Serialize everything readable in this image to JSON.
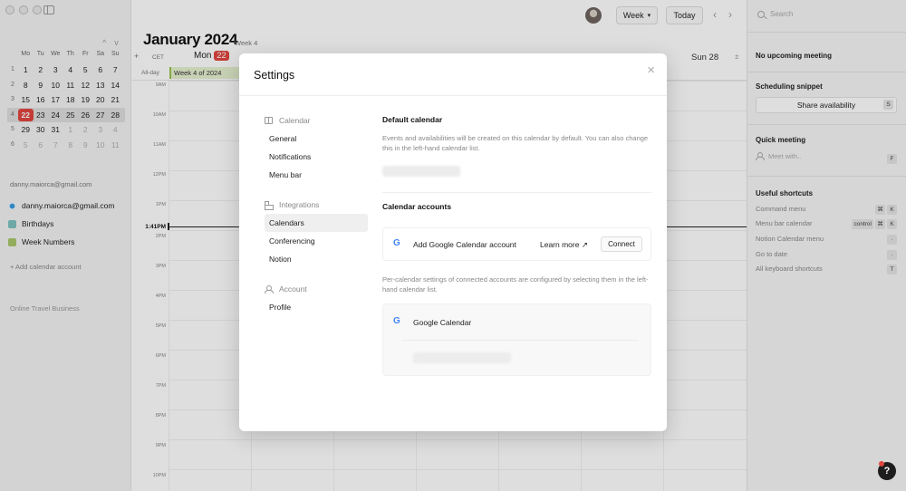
{
  "app": {
    "month_title": "January 2024",
    "week_tag": "Week 4",
    "view_label": "Week",
    "today_label": "Today",
    "prev_label": "‹",
    "next_label": "›"
  },
  "mini_calendar": {
    "prev": "^",
    "next": "v",
    "weekdays": [
      "Mo",
      "Tu",
      "We",
      "Th",
      "Fr",
      "Sa",
      "Su"
    ],
    "weeks": [
      {
        "wk": "1",
        "days": [
          "1",
          "2",
          "3",
          "4",
          "5",
          "6",
          "7"
        ]
      },
      {
        "wk": "2",
        "days": [
          "8",
          "9",
          "10",
          "11",
          "12",
          "13",
          "14"
        ]
      },
      {
        "wk": "3",
        "days": [
          "15",
          "16",
          "17",
          "18",
          "19",
          "20",
          "21"
        ]
      },
      {
        "wk": "4",
        "days": [
          "22",
          "23",
          "24",
          "25",
          "26",
          "27",
          "28"
        ]
      },
      {
        "wk": "5",
        "days": [
          "29",
          "30",
          "31",
          "1",
          "2",
          "3",
          "4"
        ]
      },
      {
        "wk": "6",
        "days": [
          "5",
          "6",
          "7",
          "8",
          "9",
          "10",
          "11"
        ]
      }
    ]
  },
  "sidebar": {
    "account_email": "danny.maiorca@gmail.com",
    "calendars": [
      {
        "label": "danny.maiorca@gmail.com",
        "color": "#3b9be0"
      },
      {
        "label": "Birthdays",
        "color": "#7fc3c0"
      },
      {
        "label": "Week Numbers",
        "color": "#a8c76a"
      }
    ],
    "add_account": "+ Add calendar account",
    "workspace": "Online Travel Business"
  },
  "calendar_grid": {
    "timezone": "CET",
    "plus": "+",
    "allday_label": "All-day",
    "week_event": "Week 4 of 2024",
    "monday_label": "Mon",
    "monday_num": "22",
    "sunday_label": "Sun 28",
    "sunday_icon": "±",
    "hours": [
      "9AM",
      "10AM",
      "11AM",
      "12PM",
      "1PM",
      "2PM",
      "3PM",
      "4PM",
      "5PM",
      "6PM",
      "7PM",
      "8PM",
      "9PM",
      "10PM"
    ],
    "now_label": "1:41PM"
  },
  "right_panel": {
    "search_placeholder": "Search",
    "no_meeting": "No upcoming meeting",
    "scheduling_title": "Scheduling snippet",
    "share_label": "Share availability",
    "share_key": "S",
    "quick_title": "Quick meeting",
    "meet_placeholder": "Meet with..",
    "meet_key": "F",
    "shortcuts_title": "Useful shortcuts",
    "shortcuts": [
      {
        "label": "Command menu",
        "keys": [
          "⌘",
          "K"
        ]
      },
      {
        "label": "Menu bar calendar",
        "keys": [
          "control",
          "⌘",
          "K"
        ]
      },
      {
        "label": "Notion Calendar menu",
        "keys": [
          "·"
        ]
      },
      {
        "label": "Go to date",
        "keys": [
          "·"
        ]
      },
      {
        "label": "All keyboard shortcuts",
        "keys": [
          "T"
        ]
      }
    ]
  },
  "settings_modal": {
    "title": "Settings",
    "close": "×",
    "nav": {
      "calendar_group": "Calendar",
      "general": "General",
      "notifications": "Notifications",
      "menu_bar": "Menu bar",
      "integrations_group": "Integrations",
      "calendars": "Calendars",
      "conferencing": "Conferencing",
      "notion": "Notion",
      "account_group": "Account",
      "profile": "Profile"
    },
    "default_calendar_title": "Default calendar",
    "default_calendar_text": "Events and availabilities will be created on this calendar by default. You can also change this in the left-hand calendar list.",
    "calendar_accounts_title": "Calendar accounts",
    "add_google_label": "Add Google Calendar account",
    "learn_more": "Learn more ↗",
    "connect": "Connect",
    "per_calendar_text": "Per-calendar settings of connected accounts are configured by selecting them in the left-hand calendar list.",
    "google_calendar_label": "Google Calendar",
    "google_g": "G"
  },
  "help": {
    "label": "?"
  },
  "colors": {
    "accent_red": "#e0453d",
    "week_event_bg": "#e5f0cf",
    "week_event_border": "#9bc14a"
  }
}
